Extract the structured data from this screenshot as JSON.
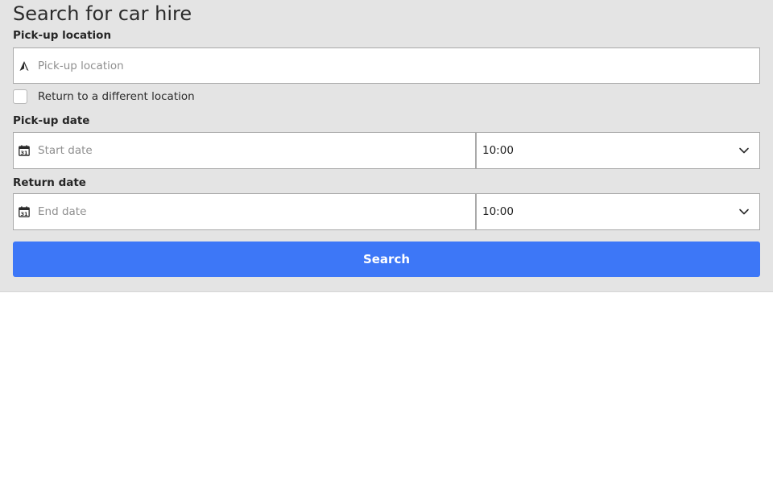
{
  "form": {
    "title": "Search for car hire",
    "pickup_location": {
      "label": "Pick-up location",
      "placeholder": "Pick-up location",
      "value": "",
      "icon": "location-arrow-icon"
    },
    "different_location": {
      "label": "Return to a different location",
      "checked": false
    },
    "pickup_date": {
      "label": "Pick-up date",
      "placeholder": "Start date",
      "value": "",
      "icon": "calendar-icon",
      "time_value": "10:00"
    },
    "return_date": {
      "label": "Return date",
      "placeholder": "End date",
      "value": "",
      "icon": "calendar-icon",
      "time_value": "10:00"
    },
    "search_label": "Search"
  },
  "colors": {
    "panel_background": "#e4e4e4",
    "accent": "#3d77f7",
    "field_border": "#a9a9a9"
  }
}
